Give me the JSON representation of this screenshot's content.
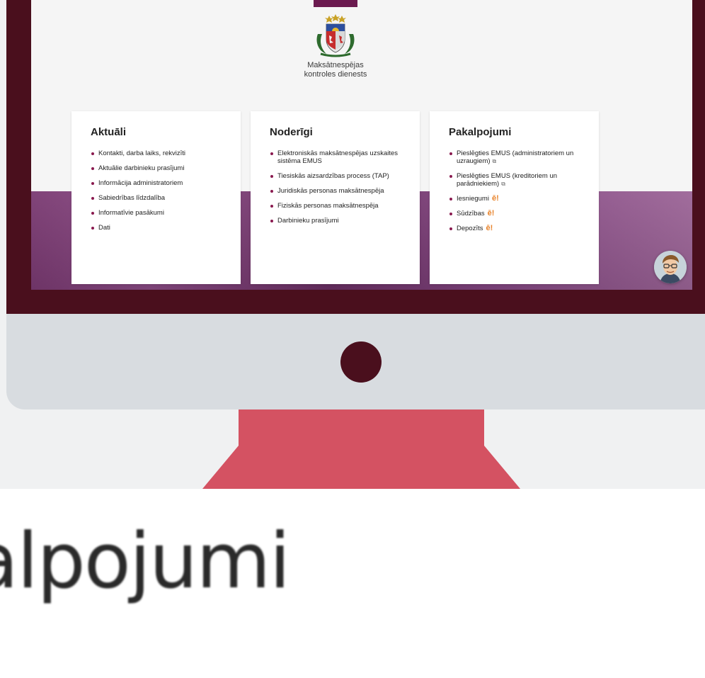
{
  "org": {
    "name_line1": "Maksātnespējas",
    "name_line2": "kontroles dienests"
  },
  "cards": [
    {
      "title": "Aktuāli",
      "items": [
        "Kontakti, darba laiks, rekvizīti",
        "Aktuālie darbinieku prasījumi",
        "Informācija administratoriem",
        "Sabiedrības līdzdalība",
        "Informatīvie pasākumi",
        "Dati"
      ]
    },
    {
      "title": "Noderīgi",
      "items": [
        "Elektroniskās maksātnespējas uzskaites sistēma EMUS",
        "Tiesiskās aizsardzības process (TAP)",
        "Juridiskās personas maksātnespēja",
        "Fiziskās personas maksātnespēja",
        "Darbinieku prasījumi"
      ]
    },
    {
      "title": "Pakalpojumi",
      "items": [
        "Pieslēgties EMUS (administratoriem un uzraugiem)",
        "Pieslēgties EMUS (kreditoriem un parādniekiem)",
        "Iesniegumi",
        "Sūdzības",
        "Depozīts"
      ]
    }
  ],
  "zoom_text": "alpojumi",
  "colors": {
    "bezel": "#4a0f1d",
    "stand": "#d45262",
    "bullet": "#8a1a4f",
    "e_service": "#e8832b"
  },
  "icons": {
    "external_link": "external-link-icon",
    "e_service": "e-service-icon",
    "assistant": "assistant-avatar"
  }
}
